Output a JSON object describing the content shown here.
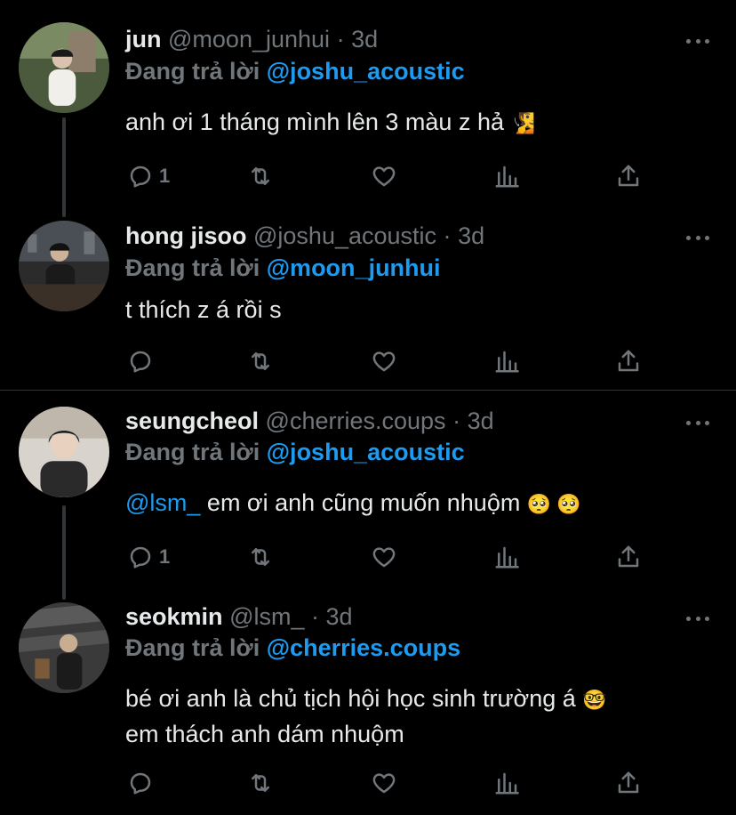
{
  "tweets": [
    {
      "display_name": "jun",
      "handle": "@moon_junhui",
      "separator": "·",
      "time": "3d",
      "reply_prefix": "Đang trả lời",
      "reply_to": "@joshu_acoustic",
      "text": "anh ơi 1 tháng mình lên 3 màu z hả",
      "text_emoji": "🧏",
      "reply_count": "1"
    },
    {
      "display_name": "hong jisoo",
      "handle": "@joshu_acoustic",
      "separator": "·",
      "time": "3d",
      "reply_prefix": "Đang trả lời",
      "reply_to": "@moon_junhui",
      "text": "t thích z á rồi s",
      "reply_count": ""
    },
    {
      "display_name": "seungcheol",
      "handle": "@cherries.coups",
      "separator": "·",
      "time": "3d",
      "reply_prefix": "Đang trả lời",
      "reply_to": "@joshu_acoustic",
      "text_mention": "@lsm_",
      "text": " em ơi anh cũng muốn nhuộm",
      "text_emoji": "🥺 🥺",
      "reply_count": "1"
    },
    {
      "display_name": "seokmin",
      "handle": "@lsm_",
      "separator": "·",
      "time": "3d",
      "reply_prefix": "Đang trả lời",
      "reply_to": "@cherries.coups",
      "text": "bé ơi anh là chủ tịch hội học sinh trường á",
      "text_emoji": "🤓",
      "text_line2": "em thách anh dám nhuộm",
      "reply_count": ""
    }
  ],
  "icons": {
    "reply": "reply-icon",
    "retweet": "retweet-icon",
    "like": "heart-icon",
    "analytics": "analytics-icon",
    "share": "share-icon",
    "more": "more-icon"
  },
  "colors": {
    "background": "#000000",
    "text": "#e7e9ea",
    "muted": "#71767b",
    "accent": "#1d9bf0",
    "divider": "#2f3336"
  }
}
